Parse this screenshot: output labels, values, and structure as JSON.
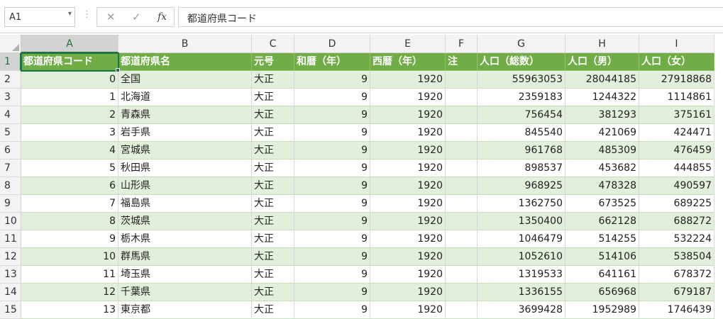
{
  "formula_bar": {
    "name_box": "A1",
    "name_box_arrow": "▾",
    "dots": "⋮",
    "cancel_glyph": "✕",
    "enter_glyph": "✓",
    "function_label": "fx",
    "content": "都道府県コード"
  },
  "grid": {
    "columns": [
      "A",
      "B",
      "C",
      "D",
      "E",
      "F",
      "G",
      "H",
      "I"
    ],
    "row_numbers": [
      "1",
      "2",
      "3",
      "4",
      "5",
      "6",
      "7",
      "8",
      "9",
      "10",
      "11",
      "12",
      "13",
      "14",
      "15"
    ],
    "header_row": [
      "都道府県コード",
      "都道府県名",
      "元号",
      "和暦（年）",
      "西暦（年）",
      "注",
      "人口（総数）",
      "人口（男）",
      "人口（女）"
    ],
    "rows": [
      [
        "0",
        "全国",
        "大正",
        "9",
        "1920",
        "",
        "55963053",
        "28044185",
        "27918868"
      ],
      [
        "1",
        "北海道",
        "大正",
        "9",
        "1920",
        "",
        "2359183",
        "1244322",
        "1114861"
      ],
      [
        "2",
        "青森県",
        "大正",
        "9",
        "1920",
        "",
        "756454",
        "381293",
        "375161"
      ],
      [
        "3",
        "岩手県",
        "大正",
        "9",
        "1920",
        "",
        "845540",
        "421069",
        "424471"
      ],
      [
        "4",
        "宮城県",
        "大正",
        "9",
        "1920",
        "",
        "961768",
        "485309",
        "476459"
      ],
      [
        "5",
        "秋田県",
        "大正",
        "9",
        "1920",
        "",
        "898537",
        "453682",
        "444855"
      ],
      [
        "6",
        "山形県",
        "大正",
        "9",
        "1920",
        "",
        "968925",
        "478328",
        "490597"
      ],
      [
        "7",
        "福島県",
        "大正",
        "9",
        "1920",
        "",
        "1362750",
        "673525",
        "689225"
      ],
      [
        "8",
        "茨城県",
        "大正",
        "9",
        "1920",
        "",
        "1350400",
        "662128",
        "688272"
      ],
      [
        "9",
        "栃木県",
        "大正",
        "9",
        "1920",
        "",
        "1046479",
        "514255",
        "532224"
      ],
      [
        "10",
        "群馬県",
        "大正",
        "9",
        "1920",
        "",
        "1052610",
        "514106",
        "538504"
      ],
      [
        "11",
        "埼玉県",
        "大正",
        "9",
        "1920",
        "",
        "1319533",
        "641161",
        "678372"
      ],
      [
        "12",
        "千葉県",
        "大正",
        "9",
        "1920",
        "",
        "1336155",
        "656968",
        "679187"
      ],
      [
        "13",
        "東京都",
        "大正",
        "9",
        "1920",
        "",
        "3699428",
        "1952989",
        "1746439"
      ]
    ],
    "numeric_columns": [
      0,
      3,
      4,
      6,
      7,
      8
    ],
    "active_cell": "A1"
  },
  "colors": {
    "header_fill": "#70ad47",
    "band_fill": "#e2efda",
    "selection_accent": "#217346"
  }
}
